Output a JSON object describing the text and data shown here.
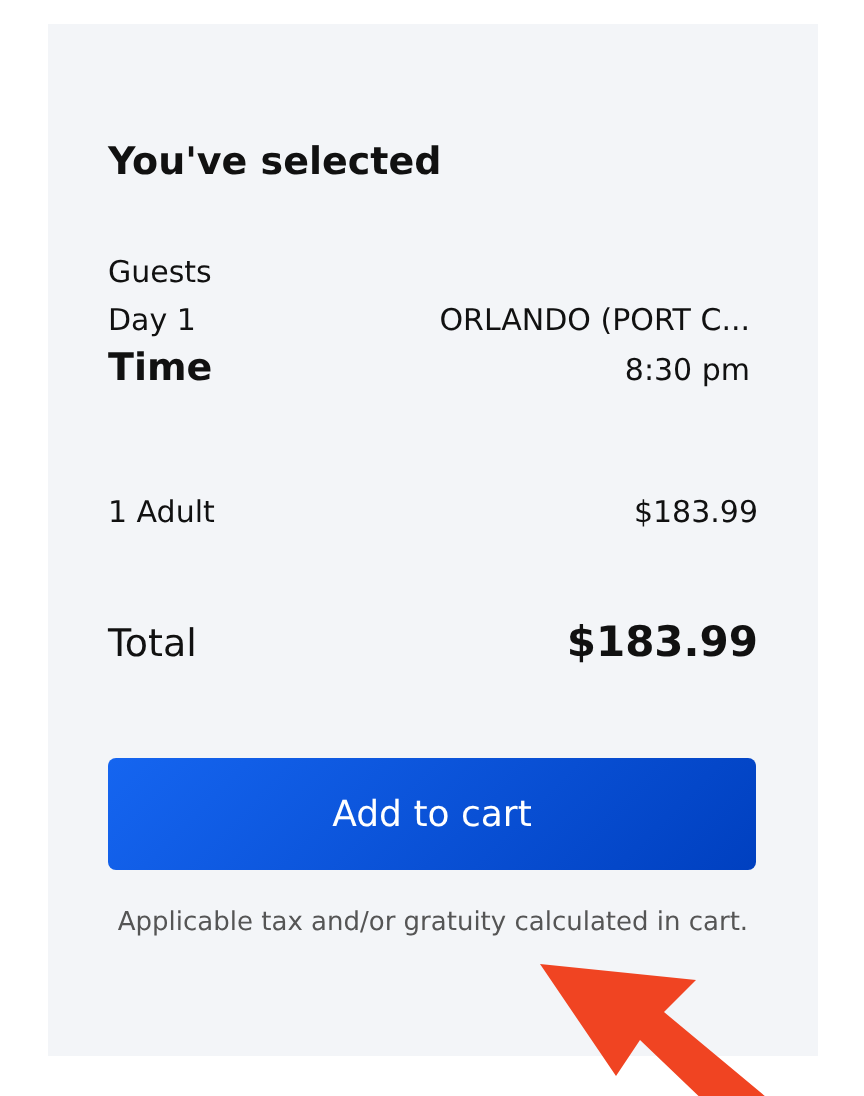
{
  "summary": {
    "title": "You've selected",
    "details": [
      {
        "label": "Guests",
        "kind": "plain"
      },
      {
        "label": "Day 1",
        "value": "ORLANDO (PORT C...",
        "kind": "plain"
      },
      {
        "label": "Time",
        "value": "8:30 pm",
        "kind": "bold"
      }
    ],
    "line_item": {
      "label": "1 Adult",
      "price": "$183.99"
    },
    "total": {
      "label": "Total",
      "price": "$183.99"
    },
    "button": "Add to cart",
    "note": "Applicable tax and/or gratuity calculated in cart."
  }
}
